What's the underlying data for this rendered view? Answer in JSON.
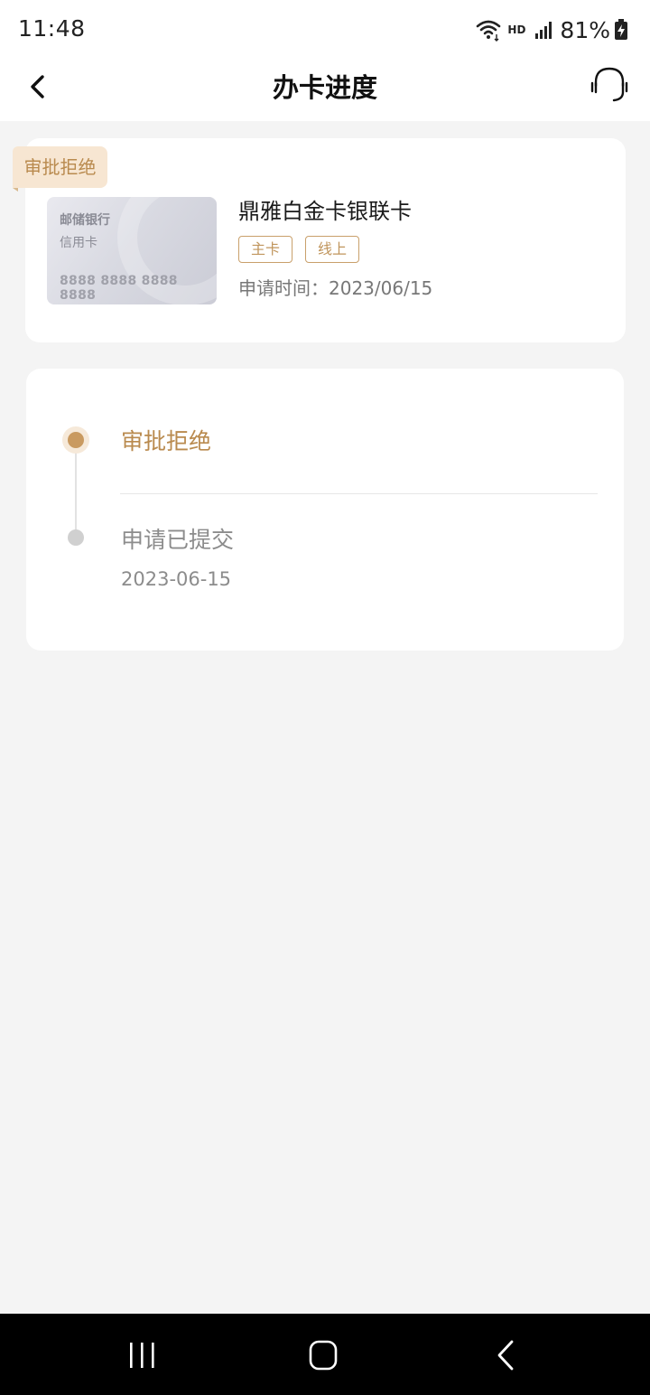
{
  "status_bar": {
    "time": "11:48",
    "network": "HD",
    "battery": "81%"
  },
  "nav": {
    "title": "办卡进度",
    "back_icon": "chevron-left-icon",
    "service_icon": "headset-icon"
  },
  "application": {
    "status_tag": "审批拒绝",
    "card_image": {
      "bank": "邮储银行",
      "type": "信用卡",
      "number": "8888 8888 8888 8888"
    },
    "card_name": "鼎雅白金卡银联卡",
    "badges": [
      "主卡",
      "线上"
    ],
    "apply_time": "申请时间：2023/06/15"
  },
  "progress": {
    "steps": [
      {
        "title": "审批拒绝",
        "active": true
      },
      {
        "title": "申请已提交",
        "date": "2023-06-15",
        "active": false
      }
    ]
  },
  "colors": {
    "accent": "#b98a4e",
    "tag_bg": "#f7e6d2"
  }
}
